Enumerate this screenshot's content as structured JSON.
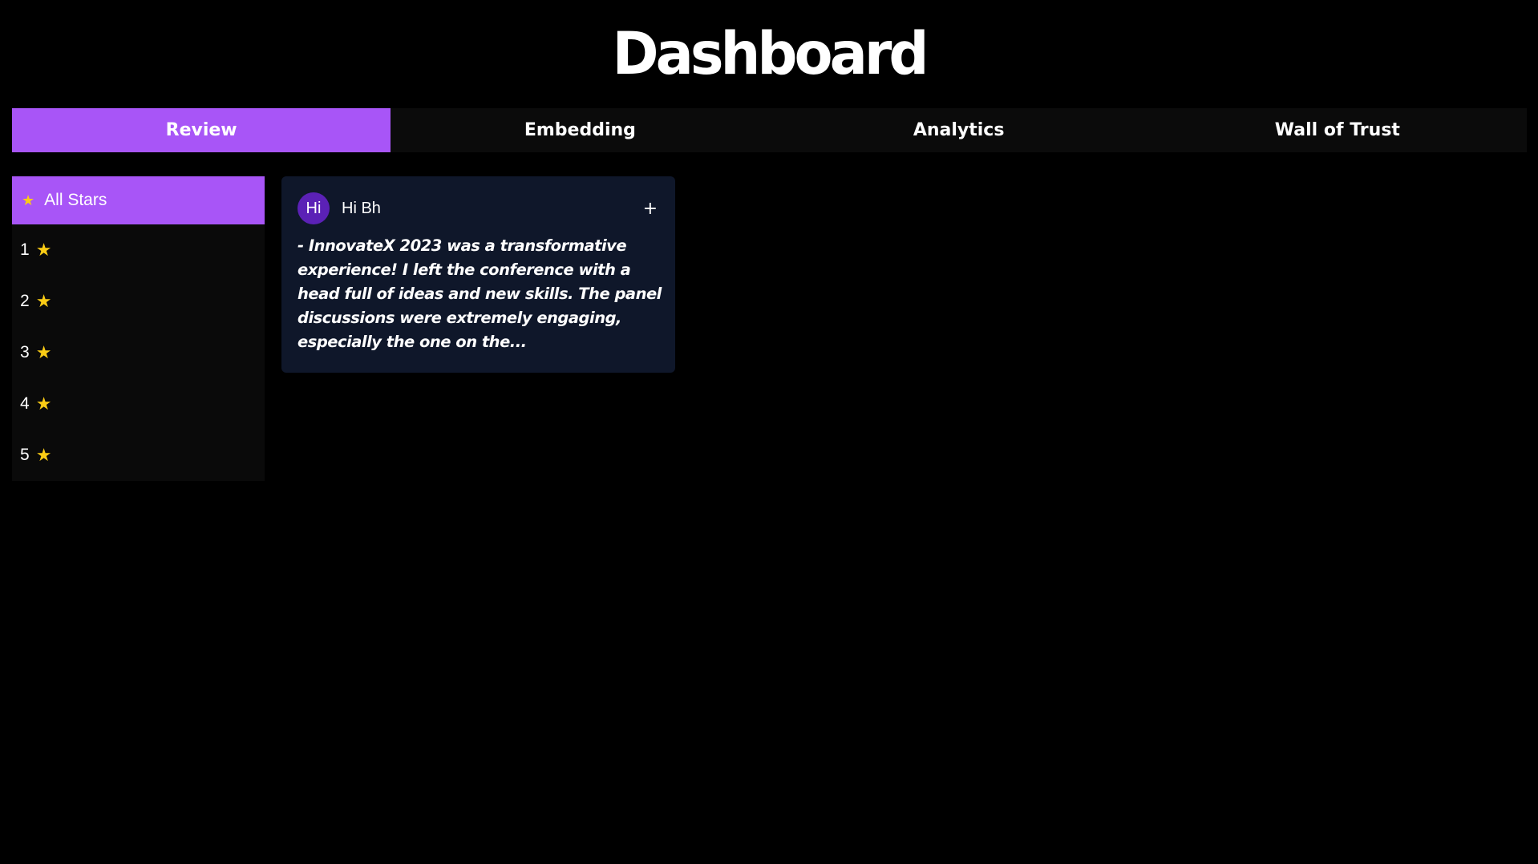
{
  "header": {
    "title": "Dashboard"
  },
  "tabs": [
    {
      "label": "Review",
      "active": true
    },
    {
      "label": "Embedding",
      "active": false
    },
    {
      "label": "Analytics",
      "active": false
    },
    {
      "label": "Wall of Trust",
      "active": false
    }
  ],
  "sidebar": {
    "items": [
      {
        "label": "All Stars",
        "icon": "star-icon",
        "active": true
      },
      {
        "label": "1",
        "icon": "star-icon",
        "active": false
      },
      {
        "label": "2",
        "icon": "star-icon",
        "active": false
      },
      {
        "label": "3",
        "icon": "star-icon",
        "active": false
      },
      {
        "label": "4",
        "icon": "star-icon",
        "active": false
      },
      {
        "label": "5",
        "icon": "star-icon",
        "active": false
      }
    ]
  },
  "review_card": {
    "avatar_initials": "Hi",
    "author": "Hi Bh",
    "action_label": "+",
    "text": "- InnovateX 2023 was a transformative experience! I left the conference with a head full of ideas and new skills. The panel discussions were extremely engaging, especially the one on the..."
  },
  "colors": {
    "accent": "#a855f7",
    "star": "#facc15",
    "card_bg": "#0f172a",
    "avatar_bg": "#5b21b6",
    "background": "#000000"
  }
}
